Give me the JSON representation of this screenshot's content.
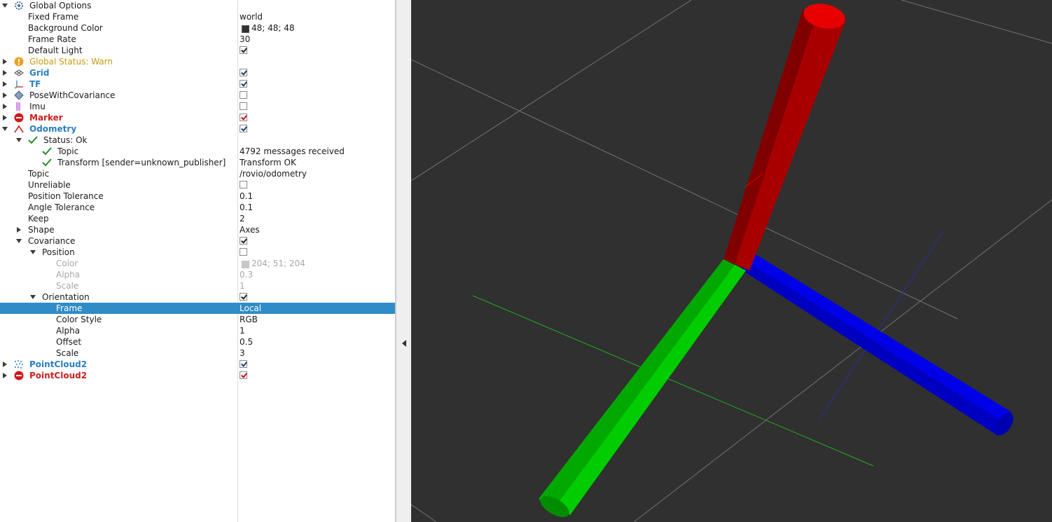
{
  "tree": {
    "global_options": {
      "label": "Global Options",
      "fixed_frame": {
        "label": "Fixed Frame",
        "value": "world"
      },
      "background_color": {
        "label": "Background Color",
        "value": "48; 48; 48",
        "swatch": "#303030"
      },
      "frame_rate": {
        "label": "Frame Rate",
        "value": "30"
      },
      "default_light": {
        "label": "Default Light",
        "checked": true
      }
    },
    "global_status": {
      "label": "Global Status: Warn"
    },
    "grid": {
      "label": "Grid",
      "checked": true
    },
    "tf": {
      "label": "TF",
      "checked": true
    },
    "pose_with_covariance": {
      "label": "PoseWithCovariance",
      "checked": false
    },
    "imu": {
      "label": "Imu",
      "checked": false
    },
    "marker": {
      "label": "Marker",
      "checked": true
    },
    "odometry": {
      "label": "Odometry",
      "checked": true,
      "status": {
        "label": "Status: Ok"
      },
      "status_topic": {
        "label": "Topic",
        "value": "4792 messages received"
      },
      "status_transform": {
        "label": "Transform [sender=unknown_publisher]",
        "value": "Transform OK"
      },
      "topic": {
        "label": "Topic",
        "value": "/rovio/odometry"
      },
      "unreliable": {
        "label": "Unreliable",
        "checked": false
      },
      "position_tolerance": {
        "label": "Position Tolerance",
        "value": "0.1"
      },
      "angle_tolerance": {
        "label": "Angle Tolerance",
        "value": "0.1"
      },
      "keep": {
        "label": "Keep",
        "value": "2"
      },
      "shape": {
        "label": "Shape",
        "value": "Axes"
      },
      "covariance": {
        "label": "Covariance",
        "checked": true,
        "position": {
          "label": "Position",
          "checked": false,
          "color": {
            "label": "Color",
            "value": "204; 51; 204",
            "swatch": "#c8c8c8"
          },
          "alpha": {
            "label": "Alpha",
            "value": "0.3"
          },
          "scale": {
            "label": "Scale",
            "value": "1"
          }
        },
        "orientation": {
          "label": "Orientation",
          "checked": true,
          "frame": {
            "label": "Frame",
            "value": "Local"
          },
          "color_style": {
            "label": "Color Style",
            "value": "RGB"
          },
          "alpha": {
            "label": "Alpha",
            "value": "1"
          },
          "offset": {
            "label": "Offset",
            "value": "0.5"
          },
          "scale": {
            "label": "Scale",
            "value": "3"
          }
        }
      }
    },
    "pointcloud2_a": {
      "label": "PointCloud2",
      "checked": true
    },
    "pointcloud2_b": {
      "label": "PointCloud2",
      "checked": true
    }
  },
  "colors": {
    "selection": "#308cc6",
    "viewport_bg": "#303030",
    "ok_blue": "#2a7ec2",
    "error_red": "#cc1f1f",
    "warn_yellow": "#c99a10",
    "axis_x": "#cc0000",
    "axis_y": "#00cc00",
    "axis_z": "#0000ee"
  },
  "icons": {
    "global_options": "gear-icon",
    "global_status": "warning-icon",
    "grid": "grid-icon",
    "tf": "axes-icon",
    "pose_with_covariance": "diamond-icon",
    "imu": "imu-icon",
    "marker": "error-icon",
    "odometry": "odometry-arrow-icon",
    "status_ok": "checkmark-icon",
    "pointcloud2_a": "pointcloud-icon",
    "pointcloud2_b": "error-icon"
  }
}
